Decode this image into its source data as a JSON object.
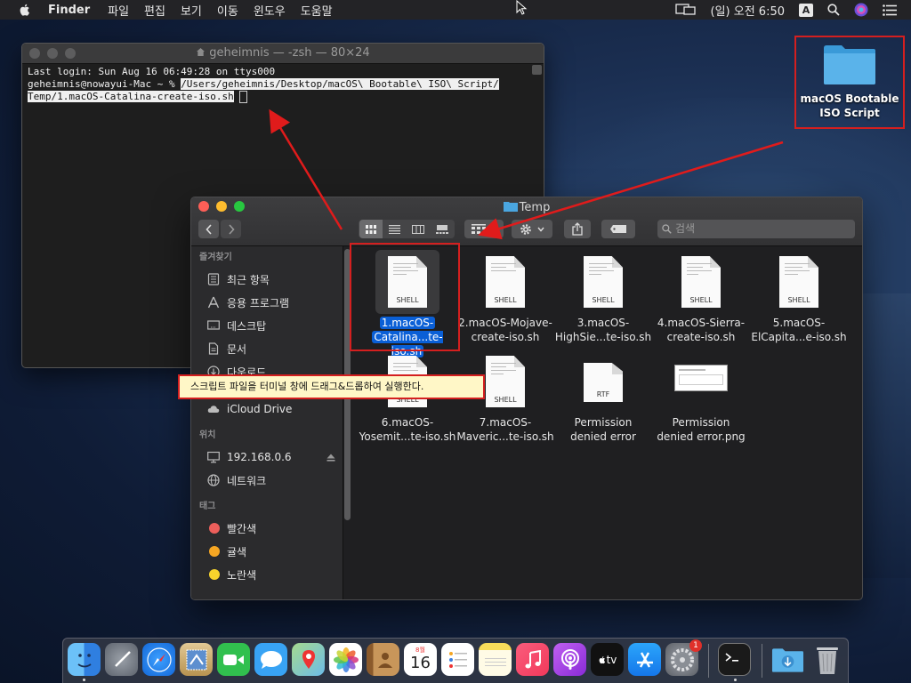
{
  "menubar": {
    "app_name": "Finder",
    "menus": [
      "파일",
      "편집",
      "보기",
      "이동",
      "윈도우",
      "도움말"
    ],
    "clock": "(일) 오전 6:50",
    "input_source": "A"
  },
  "terminal": {
    "title": "geheimnis — -zsh — 80×24",
    "line1": "Last login: Sun Aug 16 06:49:28 on ttys000",
    "prompt": "geheimnis@nowayui-Mac ~ % ",
    "path_part1": "/Users/geheimnis/Desktop/macOS\\ Bootable\\ ISO\\ Script/",
    "path_part2": "Temp/1.macOS-Catalina-create-iso.sh"
  },
  "desktop_folder": {
    "label_line1": "macOS Bootable",
    "label_line2": "ISO Script"
  },
  "finder": {
    "title": "Temp",
    "search_placeholder": "검색",
    "sidebar": {
      "favorites_header": "즐겨찾기",
      "favorites": [
        "최근 항목",
        "응용 프로그램",
        "데스크탑",
        "문서",
        "다운로드"
      ],
      "icloud_header": "iCloud",
      "icloud_drive": "iCloud Drive",
      "locations_header": "위치",
      "locations": [
        "192.168.0.6",
        "네트워크"
      ],
      "tags_header": "태그",
      "tags": [
        {
          "name": "빨간색",
          "color": "#ec5f5b"
        },
        {
          "name": "귤색",
          "color": "#f5a623"
        },
        {
          "name": "노란색",
          "color": "#f8d42c"
        }
      ]
    },
    "files": [
      {
        "line1": "1.macOS-",
        "line2": "Catalina...te-iso.sh",
        "kind": "SHELL",
        "selected": true
      },
      {
        "line1": "2.macOS-Mojave-",
        "line2": "create-iso.sh",
        "kind": "SHELL"
      },
      {
        "line1": "3.macOS-",
        "line2": "HighSie...te-iso.sh",
        "kind": "SHELL"
      },
      {
        "line1": "4.macOS-Sierra-",
        "line2": "create-iso.sh",
        "kind": "SHELL"
      },
      {
        "line1": "5.macOS-",
        "line2": "ElCapita...e-iso.sh",
        "kind": "SHELL"
      },
      {
        "line1": "6.macOS-",
        "line2": "Yosemit...te-iso.sh",
        "kind": "SHELL"
      },
      {
        "line1": "7.macOS-",
        "line2": "Maveric...te-iso.sh",
        "kind": "SHELL"
      },
      {
        "line1": "Permission",
        "line2": "denied error",
        "kind": "RTF"
      },
      {
        "line1": "Permission",
        "line2": "denied error.png",
        "kind": "PNG"
      }
    ]
  },
  "annotation": {
    "text": "스크립트 파일을 터미널 창에 드래그&드롭하여 실행한다."
  },
  "dock": {
    "calendar_month": "8월",
    "calendar_day": "16",
    "system_prefs_badge": "1",
    "appletv_label": "tv",
    "colors": {
      "finder": "#3d8ee8",
      "launchpad": "#7a7f88",
      "safari": "#1f7ce0",
      "facetime": "#31c04e",
      "messages": "#38a3f4",
      "music": "#f2395b",
      "podcasts": "#9c3fe0",
      "appstore": "#1d8cf4"
    }
  }
}
